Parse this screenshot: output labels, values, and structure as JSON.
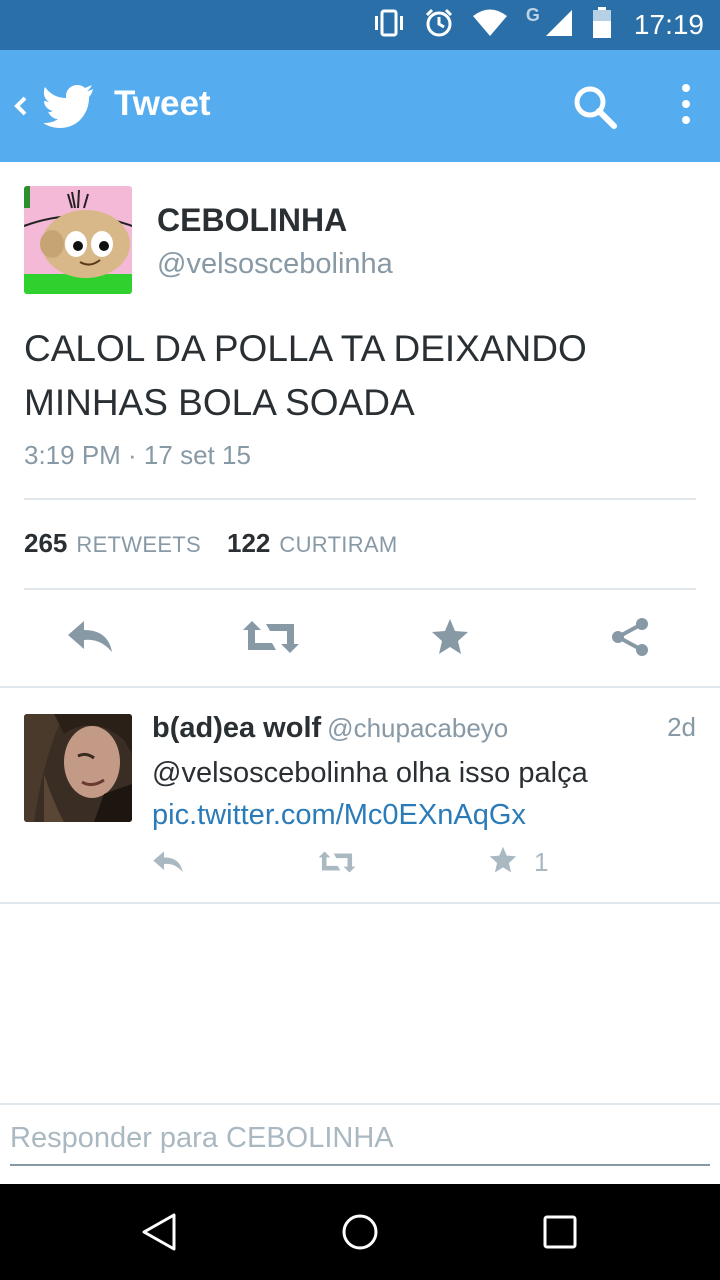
{
  "status_bar": {
    "time": "17:19",
    "network_letter": "G",
    "icons": [
      "vibrate-icon",
      "alarm-icon",
      "wifi-icon",
      "signal-icon",
      "battery-icon"
    ]
  },
  "app_bar": {
    "title": "Tweet",
    "background": "#55acee"
  },
  "tweet": {
    "display_name": "CEBOLINHA",
    "handle": "@velsoscebolinha",
    "text": "CALOL DA POLLA TA DEIXANDO MINHAS BOLA SOADA",
    "date": "3:19 PM · 17 set 15",
    "retweets_count": "265",
    "retweets_label": "RETWEETS",
    "likes_count": "122",
    "likes_label": "CURTIRAM"
  },
  "reply": {
    "display_name": "b(ad)ea wolf",
    "handle": "@chupacabeyo",
    "time": "2d",
    "text": "@velsoscebolinha olha isso palça",
    "link": "pic.twitter.com/Mc0EXnAqGx",
    "favorite_count": "1"
  },
  "compose": {
    "placeholder": "Responder para CEBOLINHA"
  },
  "colors": {
    "status_bar": "#2a6fa8",
    "link": "#2b7bb9",
    "secondary_text": "#8899a6",
    "icon_gray": "#8899a6"
  }
}
